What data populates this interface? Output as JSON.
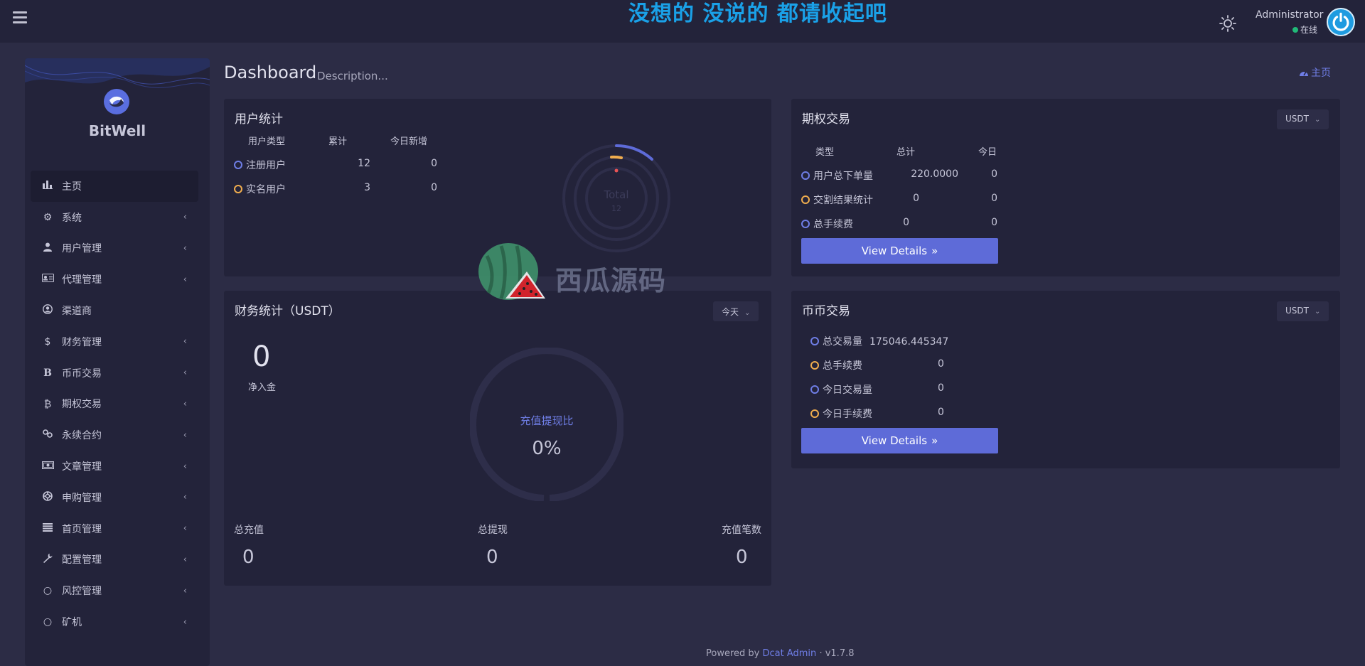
{
  "header": {
    "banner": "没想的 没说的 都请收起吧",
    "user_name": "Administrator",
    "user_status": "在线"
  },
  "sidebar": {
    "brand": "BitWell",
    "items": [
      {
        "label": "主页",
        "icon": "bar-chart-icon",
        "active": true,
        "has_children": false
      },
      {
        "label": "系统",
        "icon": "gear-icon",
        "has_children": true
      },
      {
        "label": "用户管理",
        "icon": "user-icon",
        "has_children": true
      },
      {
        "label": "代理管理",
        "icon": "id-card-icon",
        "has_children": true
      },
      {
        "label": "渠道商",
        "icon": "user-circle-icon",
        "has_children": false
      },
      {
        "label": "财务管理",
        "icon": "dollar-icon",
        "has_children": true
      },
      {
        "label": "币币交易",
        "icon": "bitcoin-b-icon",
        "has_children": true
      },
      {
        "label": "期权交易",
        "icon": "bitcoin-icon",
        "has_children": true
      },
      {
        "label": "永续合约",
        "icon": "link-icon",
        "has_children": true
      },
      {
        "label": "文章管理",
        "icon": "money-bill-icon",
        "has_children": true
      },
      {
        "label": "申购管理",
        "icon": "lifebuoy-icon",
        "has_children": true
      },
      {
        "label": "首页管理",
        "icon": "list-icon",
        "has_children": true
      },
      {
        "label": "配置管理",
        "icon": "wrench-icon",
        "has_children": true
      },
      {
        "label": "风控管理",
        "icon": "circle-icon",
        "has_children": true
      },
      {
        "label": "矿机",
        "icon": "circle-icon",
        "has_children": true
      }
    ]
  },
  "page": {
    "title": "Dashboard",
    "description": "Description...",
    "breadcrumb": "主页"
  },
  "user_stats": {
    "title": "用户统计",
    "columns": [
      "用户类型",
      "累计",
      "今日新增"
    ],
    "rows": [
      {
        "type": "注册用户",
        "total": "12",
        "today": "0",
        "color": "blue"
      },
      {
        "type": "实名用户",
        "total": "3",
        "today": "0",
        "color": "orange"
      }
    ],
    "ring_label": "Total",
    "ring_value": "12"
  },
  "options": {
    "title": "期权交易",
    "currency": "USDT",
    "columns": [
      "类型",
      "总计",
      "今日"
    ],
    "rows": [
      {
        "type": "用户总下单量",
        "total": "220.0000",
        "today": "0",
        "color": "blue"
      },
      {
        "type": "交割结果统计",
        "total": "0",
        "today": "0",
        "color": "orange"
      },
      {
        "type": "总手续费",
        "total": "0",
        "today": "0",
        "color": "blue"
      }
    ],
    "button": "View Details"
  },
  "finance": {
    "title": "财务统计（USDT）",
    "period": "今天",
    "net_value": "0",
    "net_label": "净入金",
    "ratio_label": "充值提现比",
    "ratio_value": "0%",
    "ratio_fraction": 0,
    "totals": [
      {
        "label": "总充值",
        "value": "0"
      },
      {
        "label": "总提现",
        "value": "0"
      },
      {
        "label": "充值笔数",
        "value": "0"
      }
    ]
  },
  "spot": {
    "title": "币币交易",
    "currency": "USDT",
    "rows": [
      {
        "label": "总交易量",
        "value": "175046.445347",
        "color": "blue"
      },
      {
        "label": "总手续费",
        "value": "0",
        "color": "orange"
      },
      {
        "label": "今日交易量",
        "value": "0",
        "color": "blue"
      },
      {
        "label": "今日手续费",
        "value": "0",
        "color": "orange"
      }
    ],
    "button": "View Details"
  },
  "footer": {
    "prefix": "Powered by",
    "link": "Dcat Admin",
    "separator": "·",
    "version": "v1.7.8"
  },
  "watermark": "西瓜源码",
  "colors": {
    "accent": "#5e6bd8",
    "blue_ring": "#6f7ee6",
    "orange_ring": "#f0ad4e",
    "online": "#21b978",
    "banner": "#1aa1e8"
  }
}
